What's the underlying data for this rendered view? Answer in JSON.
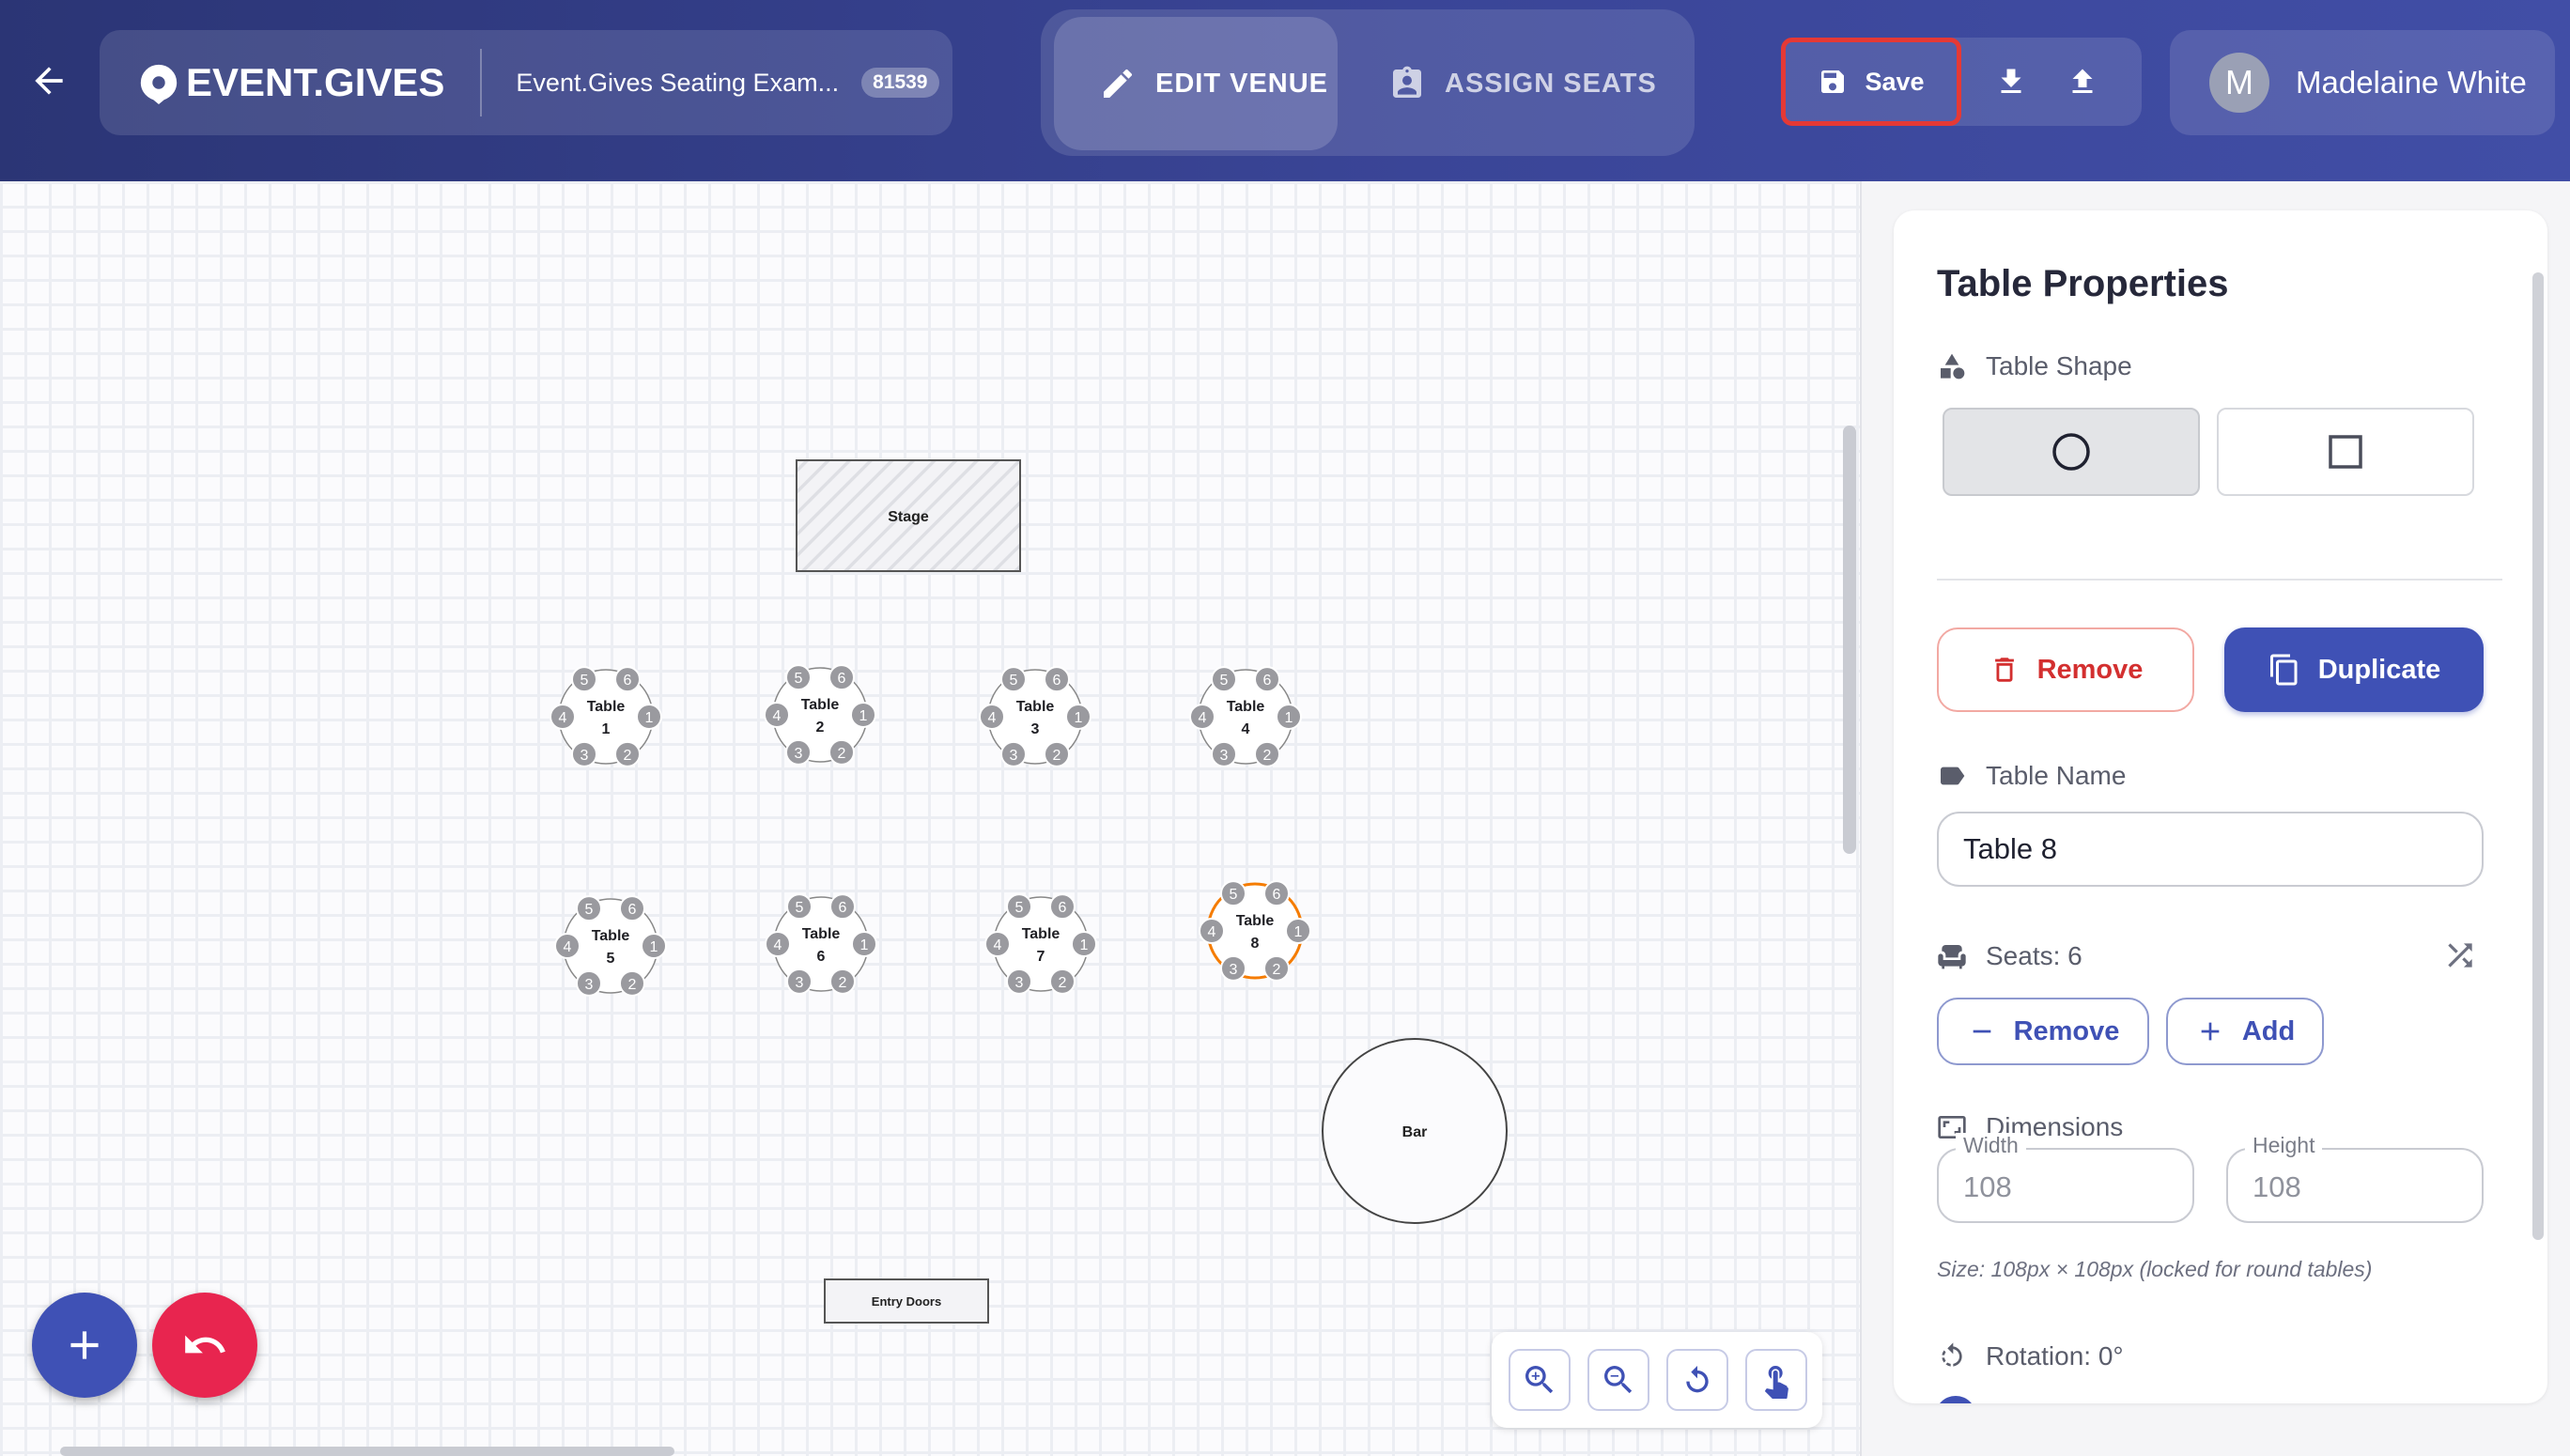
{
  "header": {
    "brand": "EVENT.GIVES",
    "event_name": "Event.Gives Seating Exam...",
    "event_id": "81539",
    "modes": {
      "edit": "EDIT VENUE",
      "assign": "ASSIGN SEATS"
    },
    "save_label": "Save",
    "user_name": "Madelaine White",
    "user_initial": "M"
  },
  "floor": {
    "stage_label": "Stage",
    "bar_label": "Bar",
    "entry_label": "Entry Doors",
    "table_word": "Table",
    "tables": [
      {
        "number": "1",
        "seats": [
          "1",
          "2",
          "3",
          "4",
          "5",
          "6"
        ],
        "selected": false
      },
      {
        "number": "2",
        "seats": [
          "1",
          "2",
          "3",
          "4",
          "5",
          "6"
        ],
        "selected": false
      },
      {
        "number": "3",
        "seats": [
          "1",
          "2",
          "3",
          "4",
          "5",
          "6"
        ],
        "selected": false
      },
      {
        "number": "4",
        "seats": [
          "1",
          "2",
          "3",
          "4",
          "5",
          "6"
        ],
        "selected": false
      },
      {
        "number": "5",
        "seats": [
          "1",
          "2",
          "3",
          "4",
          "5",
          "6"
        ],
        "selected": false
      },
      {
        "number": "6",
        "seats": [
          "1",
          "2",
          "3",
          "4",
          "5",
          "6"
        ],
        "selected": false
      },
      {
        "number": "7",
        "seats": [
          "1",
          "2",
          "3",
          "4",
          "5",
          "6"
        ],
        "selected": false
      },
      {
        "number": "8",
        "seats": [
          "1",
          "2",
          "3",
          "4",
          "5",
          "6"
        ],
        "selected": true
      }
    ]
  },
  "panel": {
    "title": "Table Properties",
    "shape_label": "Table Shape",
    "selected_shape": "circle",
    "remove_label": "Remove",
    "duplicate_label": "Duplicate",
    "name_label": "Table Name",
    "name_value": "Table 8",
    "seats_label": "Seats: 6",
    "seat_remove_label": "Remove",
    "seat_add_label": "Add",
    "dimensions_label": "Dimensions",
    "width_label": "Width",
    "width_value": "108",
    "height_label": "Height",
    "height_value": "108",
    "size_note": "Size: 108px × 108px (locked for round tables)",
    "rotation_label": "Rotation: 0°"
  },
  "colors": {
    "header_start": "#2b3575",
    "header_end": "#414ea6",
    "primary": "#3f51b5",
    "danger": "#d32f2f",
    "undo_fab": "#e8254f",
    "save_highlight": "#e53935",
    "selected_table": "#f57c00"
  }
}
